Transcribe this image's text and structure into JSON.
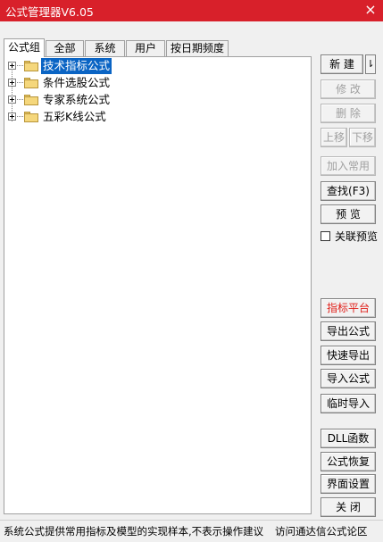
{
  "window": {
    "title": "公式管理器V6.05",
    "close_glyph": "×"
  },
  "tabs": [
    {
      "label": "公式组"
    },
    {
      "label": "全部"
    },
    {
      "label": "系统"
    },
    {
      "label": "用户"
    },
    {
      "label": "按日期频度"
    }
  ],
  "tree": {
    "items": [
      {
        "label": "技术指标公式",
        "selected": true
      },
      {
        "label": "条件选股公式",
        "selected": false
      },
      {
        "label": "专家系统公式",
        "selected": false
      },
      {
        "label": "五彩K线公式",
        "selected": false
      }
    ]
  },
  "buttons": {
    "new": "新 建",
    "new_arrow": "⇂",
    "modify": "修 改",
    "delete": "删 除",
    "move_up": "上移",
    "move_down": "下移",
    "add_common": "加入常用",
    "find": "查找(F3)",
    "preview": "预 览",
    "indicator_platform": "指标平台",
    "export_formula": "导出公式",
    "quick_export": "快速导出",
    "import_formula": "导入公式",
    "temp_import": "临时导入",
    "dll_function": "DLL函数",
    "restore_formula": "公式恢复",
    "ui_settings": "界面设置",
    "close": "关 闭"
  },
  "link_preview": {
    "label": "关联预览",
    "checked": false
  },
  "status": {
    "text": "系统公式提供常用指标及模型的实现样本,不表示操作建议",
    "link": "访问通达信公式论区"
  }
}
